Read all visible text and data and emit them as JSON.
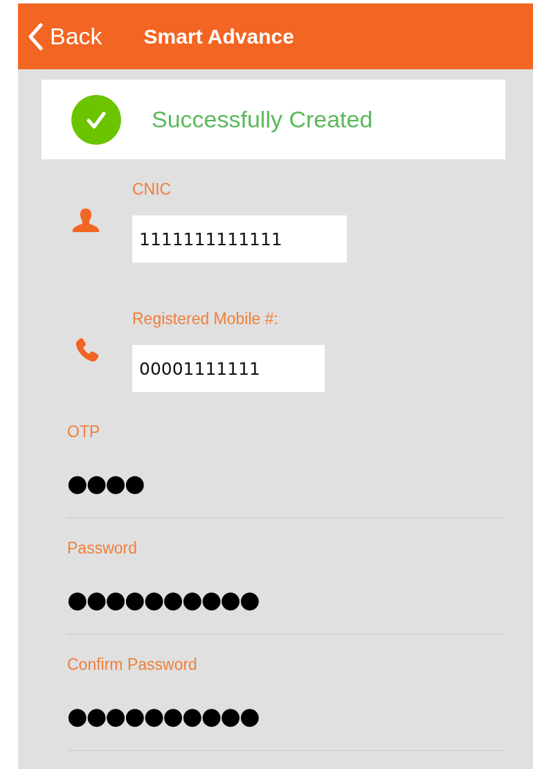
{
  "header": {
    "back_label": "Back",
    "title": "Smart Advance"
  },
  "banner": {
    "message": "Successfully Created",
    "success": true
  },
  "fields": [
    {
      "kind": "input",
      "label": "CNIC",
      "value": "1111111111111"
    },
    {
      "kind": "input",
      "label": "Registered Mobile #:",
      "value": "00001111111"
    },
    {
      "kind": "secret",
      "label": "OTP",
      "value": "●●●●"
    },
    {
      "kind": "secret",
      "label": "Password",
      "value": "●●●●●●●●●●"
    },
    {
      "kind": "secret",
      "label": "Confirm Password",
      "value": "●●●●●●●●●●"
    }
  ]
}
